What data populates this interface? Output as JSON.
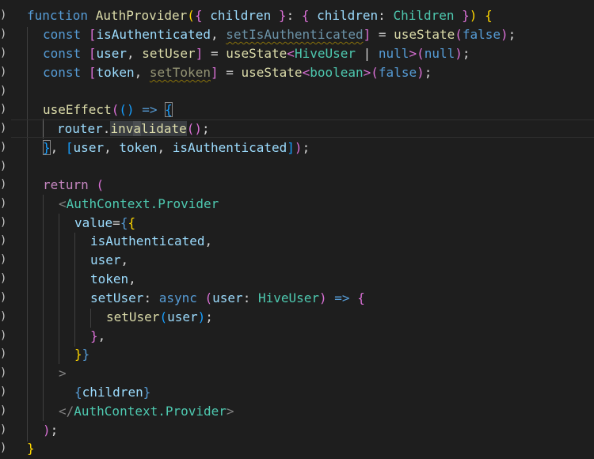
{
  "code": {
    "l1": {
      "kw_function": "function",
      "fn_name": "AuthProvider",
      "p1": "(",
      "b1": "{",
      "sp": " ",
      "param": "children",
      "b1c": "}",
      "colon": ": ",
      "b2": "{",
      "prop": "children",
      "colon2": ": ",
      "type": "Children",
      "b2c": "}",
      "p1c": ")",
      "brace": "{"
    },
    "l2": {
      "kw": "const",
      "lb": "[",
      "a": "isAuthenticated",
      "comma": ", ",
      "b": "setIsAuthenticated",
      "rb": "]",
      "eq": " = ",
      "fn": "useState",
      "p": "(",
      "val": "false",
      "pc": ")",
      "semi": ";"
    },
    "l3": {
      "kw": "const",
      "lb": "[",
      "a": "user",
      "comma": ", ",
      "b": "setUser",
      "rb": "]",
      "eq": " = ",
      "fn": "useState",
      "lt": "<",
      "t1": "HiveUser",
      "bar": " | ",
      "t2": "null",
      "gt": ">",
      "p": "(",
      "val": "null",
      "pc": ")",
      "semi": ";"
    },
    "l4": {
      "kw": "const",
      "lb": "[",
      "a": "token",
      "comma": ", ",
      "b": "setToken",
      "rb": "]",
      "eq": " = ",
      "fn": "useState",
      "lt": "<",
      "t1": "boolean",
      "gt": ">",
      "p": "(",
      "val": "false",
      "pc": ")",
      "semi": ";"
    },
    "l6": {
      "fn": "useEffect",
      "p": "(",
      "p2": "()",
      "arrow": " => ",
      "brace": "{"
    },
    "l7": {
      "obj": "router",
      "dot": ".",
      "m1": "inv",
      "m2": "a",
      "m3": "lidate",
      "call": "()",
      "semi": ";"
    },
    "l8": {
      "brace": "}",
      "comma": ", ",
      "lb": "[",
      "a": "user",
      "c1": ", ",
      "b": "token",
      "c2": ", ",
      "c": "isAuthenticated",
      "rb": "]",
      "pc": ")",
      "semi": ";"
    },
    "l10": {
      "kw": "return",
      "p": "("
    },
    "l11": {
      "lt": "<",
      "comp": "AuthContext.Provider"
    },
    "l12": {
      "attr": "value",
      "eq": "=",
      "b1": "{",
      "b2": "{"
    },
    "l13": {
      "v": "isAuthenticated",
      "comma": ","
    },
    "l14": {
      "v": "user",
      "comma": ","
    },
    "l15": {
      "v": "token",
      "comma": ","
    },
    "l16": {
      "key": "setUser",
      "colon": ": ",
      "kw": "async",
      "p": "(",
      "arg": "user",
      "colon2": ": ",
      "type": "HiveUser",
      "pc": ")",
      "arrow": " => ",
      "brace": "{"
    },
    "l17": {
      "fn": "setUser",
      "p": "(",
      "arg": "user",
      "pc": ")",
      "semi": ";"
    },
    "l18": {
      "brace": "}",
      "comma": ","
    },
    "l19": {
      "b2": "}",
      "b1": "}"
    },
    "l20": {
      "gt": ">"
    },
    "l21": {
      "b": "{",
      "v": "children",
      "bc": "}"
    },
    "l22": {
      "lt": "</",
      "comp": "AuthContext.Provider",
      "gt": ">"
    },
    "l23": {
      "pc": ")",
      "semi": ";"
    },
    "l24": {
      "brace": "}"
    }
  },
  "fold_markers": [
    ")",
    ")",
    ")",
    ")",
    ")",
    ")",
    ")",
    ")",
    ")",
    ")",
    ")",
    ")",
    ")",
    ")",
    ")",
    ")",
    ")",
    ")",
    ")",
    ")",
    ")",
    ")",
    ")",
    ")"
  ],
  "colors": {
    "background": "#1e1e1e",
    "keyword": "#569cd6",
    "control": "#c586c0",
    "function": "#dcdcaa",
    "variable": "#9cdcfe",
    "type": "#4ec9b0",
    "bracket_gold": "#ffd700",
    "bracket_orchid": "#da70d6",
    "bracket_blue": "#179fff",
    "warning_squiggle": "#cca700"
  }
}
